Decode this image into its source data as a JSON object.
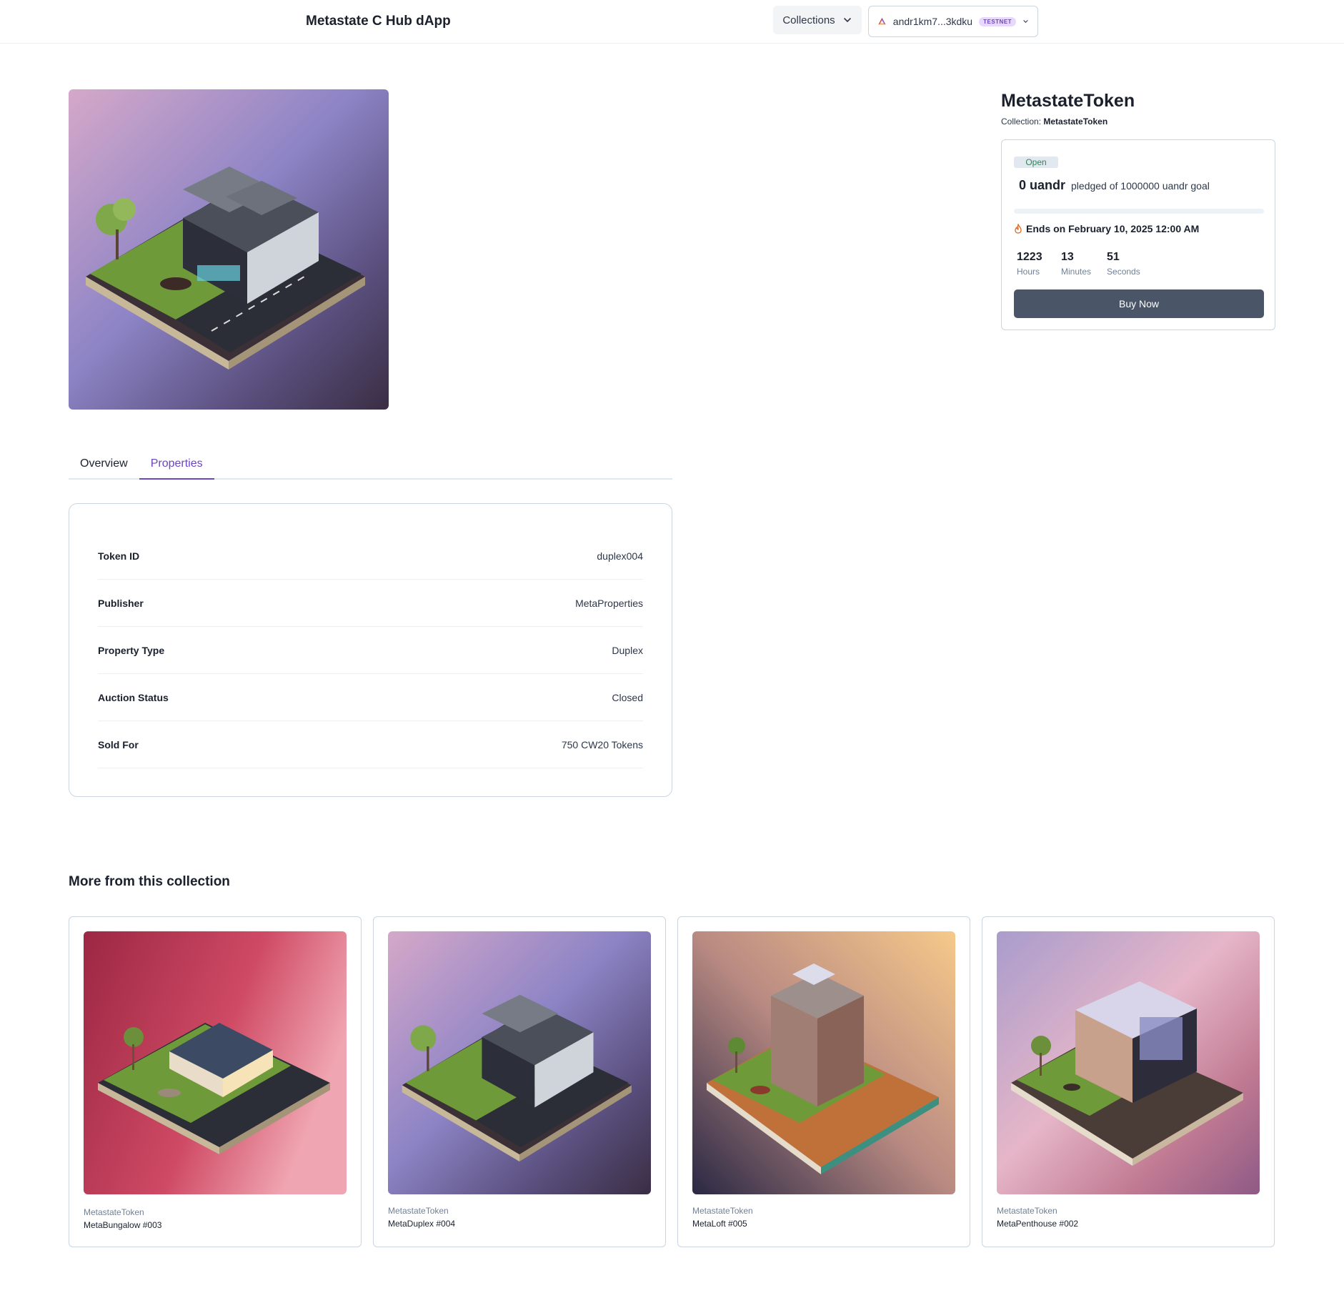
{
  "header": {
    "app_title": "Metastate C Hub dApp",
    "collections_label": "Collections",
    "wallet_address": "andr1km7...3kdku",
    "network_badge": "TESTNET"
  },
  "hero": {
    "image_icon": "isometric-duplex-house-image"
  },
  "tabs": [
    {
      "label": "Overview",
      "active": false
    },
    {
      "label": "Properties",
      "active": true
    }
  ],
  "properties": [
    {
      "label": "Token ID",
      "value": "duplex004"
    },
    {
      "label": "Publisher",
      "value": "MetaProperties"
    },
    {
      "label": "Property Type",
      "value": "Duplex"
    },
    {
      "label": "Auction Status",
      "value": "Closed"
    },
    {
      "label": "Sold For",
      "value": "750 CW20 Tokens"
    }
  ],
  "token": {
    "title": "MetastateToken",
    "collection_prefix": "Collection:",
    "collection_name": "MetastateToken"
  },
  "auction": {
    "status_badge": "Open",
    "pledged_amount": "0 uandr",
    "pledged_text": "pledged of 1000000 uandr goal",
    "progress_fraction": 0,
    "ends_text": "Ends on February 10, 2025 12:00 AM",
    "countdown": [
      {
        "value": "1223",
        "unit": "Hours"
      },
      {
        "value": "13",
        "unit": "Minutes"
      },
      {
        "value": "51",
        "unit": "Seconds"
      }
    ],
    "buy_label": "Buy Now"
  },
  "more": {
    "heading": "More from this collection",
    "items": [
      {
        "collection": "MetastateToken",
        "name": "MetaBungalow #003",
        "image_icon": "isometric-bungalow-image"
      },
      {
        "collection": "MetastateToken",
        "name": "MetaDuplex #004",
        "image_icon": "isometric-duplex-image"
      },
      {
        "collection": "MetastateToken",
        "name": "MetaLoft #005",
        "image_icon": "isometric-loft-image"
      },
      {
        "collection": "MetastateToken",
        "name": "MetaPenthouse #002",
        "image_icon": "isometric-penthouse-image"
      }
    ]
  },
  "colors": {
    "accent": "#6b46c1",
    "button": "#4a5568",
    "open_text": "#2f855a"
  }
}
